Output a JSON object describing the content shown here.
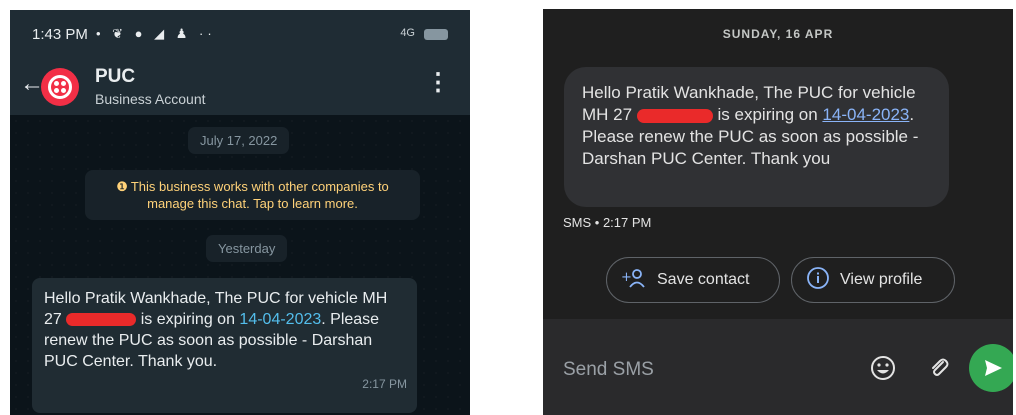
{
  "left": {
    "status_bar": {
      "time": "1:43 PM",
      "icons": "• ❦ ● ◢ ♟ ··",
      "signal": "4G"
    },
    "header": {
      "name": "PUC",
      "subtitle": "Business Account"
    },
    "date_chip": "July 17, 2022",
    "notice": "This business works with other companies to manage this chat. Tap to learn more.",
    "yesterday_chip": "Yesterday",
    "message": {
      "part1": "Hello Pratik Wankhade, The PUC for vehicle MH 27 ",
      "part2": " is expiring on ",
      "date_link": "14-04-2023",
      "part3": ". Please renew the PUC as soon as possible - Darshan PUC Center. Thank you.",
      "time": "2:17 PM"
    }
  },
  "right": {
    "date_header": "SUNDAY, 16 APR",
    "message": {
      "part1": "Hello Pratik Wankhade, The PUC for vehicle MH 27 ",
      "part2": " is expiring on ",
      "date_link": "14-04-2023",
      "part3": ". Please renew the PUC as soon as possible - Darshan PUC Center. Thank you"
    },
    "meta": "SMS • 2:17 PM",
    "save_contact": "Save contact",
    "view_profile": "View profile",
    "input_placeholder": "Send SMS"
  },
  "colors": {
    "redaction": "#ea2a2a",
    "send_button": "#34a853",
    "link_blue": "#8ab4f8"
  }
}
